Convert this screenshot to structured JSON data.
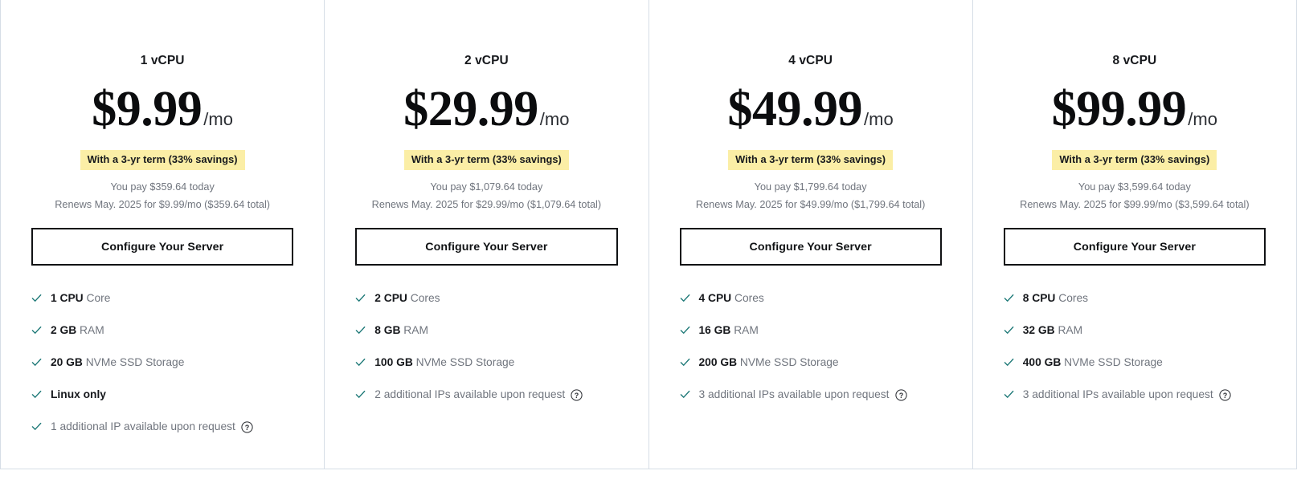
{
  "colors": {
    "badge_background": "#fbeea6",
    "check": "#1f7a78",
    "divider": "#d6dde6",
    "muted_text": "#70757e",
    "strong_text": "#16181c",
    "button_border": "#101214"
  },
  "plans": [
    {
      "title": "1 vCPU",
      "price": "$9.99",
      "period": "/mo",
      "badge": "With a 3-yr term (33% savings)",
      "pay_today": "You pay $359.64 today",
      "renewal": "Renews May. 2025 for $9.99/mo ($359.64 total)",
      "cta": "Configure Your Server",
      "features": [
        {
          "strong": "1 CPU",
          "rest": " Core",
          "help": false
        },
        {
          "strong": "2 GB",
          "rest": " RAM",
          "help": false
        },
        {
          "strong": "20 GB",
          "rest": " NVMe SSD Storage",
          "help": false
        },
        {
          "strong": "Linux only",
          "rest": "",
          "help": false
        },
        {
          "strong": "",
          "rest": "1 additional IP available upon request",
          "help": true
        }
      ]
    },
    {
      "title": "2 vCPU",
      "price": "$29.99",
      "period": "/mo",
      "badge": "With a 3-yr term (33% savings)",
      "pay_today": "You pay $1,079.64 today",
      "renewal": "Renews May. 2025 for $29.99/mo ($1,079.64 total)",
      "cta": "Configure Your Server",
      "features": [
        {
          "strong": "2 CPU",
          "rest": " Cores",
          "help": false
        },
        {
          "strong": "8 GB",
          "rest": " RAM",
          "help": false
        },
        {
          "strong": "100 GB",
          "rest": " NVMe SSD Storage",
          "help": false
        },
        {
          "strong": "",
          "rest": "2 additional IPs available upon request",
          "help": true
        }
      ]
    },
    {
      "title": "4 vCPU",
      "price": "$49.99",
      "period": "/mo",
      "badge": "With a 3-yr term (33% savings)",
      "pay_today": "You pay $1,799.64 today",
      "renewal": "Renews May. 2025 for $49.99/mo ($1,799.64 total)",
      "cta": "Configure Your Server",
      "features": [
        {
          "strong": "4 CPU",
          "rest": " Cores",
          "help": false
        },
        {
          "strong": "16 GB",
          "rest": " RAM",
          "help": false
        },
        {
          "strong": "200 GB",
          "rest": " NVMe SSD Storage",
          "help": false
        },
        {
          "strong": "",
          "rest": "3 additional IPs available upon request",
          "help": true
        }
      ]
    },
    {
      "title": "8 vCPU",
      "price": "$99.99",
      "period": "/mo",
      "badge": "With a 3-yr term (33% savings)",
      "pay_today": "You pay $3,599.64 today",
      "renewal": "Renews May. 2025 for $99.99/mo ($3,599.64 total)",
      "cta": "Configure Your Server",
      "features": [
        {
          "strong": "8 CPU",
          "rest": " Cores",
          "help": false
        },
        {
          "strong": "32 GB",
          "rest": " RAM",
          "help": false
        },
        {
          "strong": "400 GB",
          "rest": " NVMe SSD Storage",
          "help": false
        },
        {
          "strong": "",
          "rest": "3 additional IPs available upon request",
          "help": true
        }
      ]
    }
  ]
}
